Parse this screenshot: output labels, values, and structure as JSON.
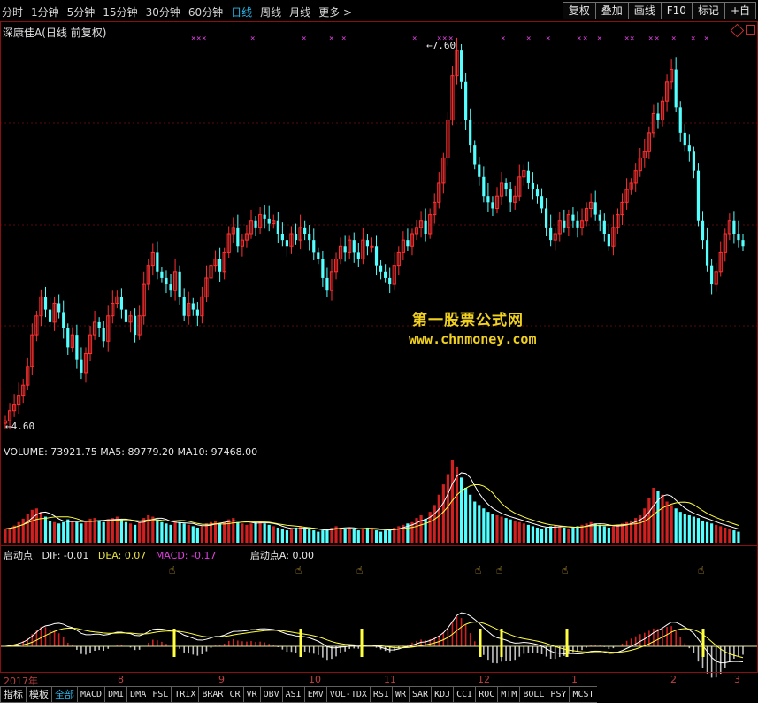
{
  "toolbar": {
    "periods": [
      "分时",
      "1分钟",
      "5分钟",
      "15分钟",
      "30分钟",
      "60分钟",
      "日线",
      "周线",
      "月线",
      "更多 >"
    ],
    "active_period": "日线",
    "tools": [
      "复权",
      "叠加",
      "画线",
      "F10",
      "标记",
      "+自"
    ]
  },
  "stock": {
    "title": "深康佳A(日线 前复权)",
    "high_label": "7.60",
    "low_label": "4.60"
  },
  "watermark": {
    "line1": "第一股票公式网",
    "line2": "www.chnmoney.com"
  },
  "volume": {
    "label": "VOLUME: 73921.75  MA5: 89779.20  MA10: 97468.00"
  },
  "macd": {
    "name": "启动点",
    "dif": "DIF: -0.01",
    "dea": "DEA: 0.07",
    "macd": "MACD: -0.17",
    "signal": "启动点A: 0.00"
  },
  "time_axis": [
    "2017年",
    "8",
    "9",
    "10",
    "11",
    "12",
    "1",
    "2",
    "3"
  ],
  "bottom_tabs": [
    "指标",
    "模板",
    "全部",
    "MACD",
    "DMI",
    "DMA",
    "FSL",
    "TRIX",
    "BRAR",
    "CR",
    "VR",
    "OBV",
    "ASI",
    "EMV",
    "VOL-TDX",
    "RSI",
    "WR",
    "SAR",
    "KDJ",
    "CCI",
    "ROC",
    "MTM",
    "BOLL",
    "PSY",
    "MCST"
  ],
  "bottom_selected": "全部",
  "colors": {
    "up": "#ff3030",
    "down": "#54ffff",
    "ma_white": "#ffffff",
    "ma_yellow": "#ffff40",
    "grid": "#8a1010",
    "signal": "#ffff40"
  },
  "chart_data": {
    "type": "candlestick",
    "price_range": [
      4.6,
      7.6
    ],
    "closes": [
      4.62,
      4.7,
      4.75,
      4.82,
      4.9,
      5.05,
      5.3,
      5.45,
      5.6,
      5.5,
      5.4,
      5.55,
      5.48,
      5.35,
      5.2,
      5.3,
      5.1,
      5.0,
      5.15,
      5.3,
      5.4,
      5.35,
      5.25,
      5.45,
      5.55,
      5.6,
      5.5,
      5.4,
      5.45,
      5.3,
      5.45,
      5.7,
      5.85,
      5.95,
      5.8,
      5.75,
      5.7,
      5.65,
      5.8,
      5.6,
      5.45,
      5.55,
      5.5,
      5.45,
      5.6,
      5.75,
      5.85,
      5.9,
      5.8,
      5.95,
      6.1,
      6.15,
      6.0,
      6.05,
      6.1,
      6.2,
      6.15,
      6.25,
      6.22,
      6.18,
      6.2,
      6.1,
      6.05,
      6.0,
      6.1,
      6.05,
      6.15,
      6.1,
      6.05,
      5.95,
      5.9,
      5.75,
      5.65,
      5.8,
      5.9,
      6.0,
      5.95,
      6.05,
      5.95,
      5.9,
      6.05,
      6.0,
      6.0,
      5.85,
      5.8,
      5.75,
      5.7,
      5.85,
      5.95,
      6.05,
      6.0,
      6.1,
      6.15,
      6.2,
      6.1,
      6.25,
      6.35,
      6.5,
      6.7,
      7.0,
      7.35,
      7.55,
      7.3,
      7.0,
      6.8,
      6.65,
      6.55,
      6.4,
      6.35,
      6.3,
      6.4,
      6.5,
      6.45,
      6.35,
      6.4,
      6.55,
      6.6,
      6.5,
      6.45,
      6.4,
      6.3,
      6.15,
      6.05,
      6.1,
      6.2,
      6.15,
      6.25,
      6.2,
      6.15,
      6.2,
      6.3,
      6.35,
      6.25,
      6.2,
      6.1,
      6.0,
      6.15,
      6.25,
      6.35,
      6.45,
      6.5,
      6.6,
      6.7,
      6.75,
      6.9,
      7.05,
      7.0,
      7.15,
      7.3,
      7.4,
      7.1,
      6.9,
      6.8,
      6.75,
      6.6,
      6.2,
      6.05,
      5.85,
      5.7,
      5.8,
      5.95,
      6.1,
      6.2,
      6.1,
      6.05,
      6.0
    ],
    "volumes": [
      20,
      22,
      25,
      30,
      35,
      42,
      48,
      50,
      45,
      38,
      32,
      30,
      28,
      30,
      34,
      32,
      30,
      28,
      30,
      35,
      36,
      32,
      30,
      34,
      36,
      38,
      34,
      30,
      28,
      26,
      30,
      36,
      40,
      38,
      34,
      30,
      28,
      26,
      32,
      30,
      28,
      26,
      24,
      22,
      24,
      28,
      30,
      32,
      28,
      30,
      34,
      36,
      30,
      28,
      26,
      28,
      30,
      32,
      28,
      26,
      24,
      22,
      20,
      18,
      20,
      22,
      24,
      22,
      20,
      18,
      16,
      18,
      20,
      22,
      24,
      22,
      20,
      22,
      20,
      18,
      20,
      22,
      20,
      18,
      16,
      18,
      20,
      22,
      24,
      26,
      28,
      30,
      36,
      40,
      35,
      45,
      55,
      70,
      85,
      100,
      120,
      110,
      95,
      80,
      70,
      60,
      55,
      50,
      45,
      42,
      40,
      38,
      36,
      34,
      32,
      30,
      28,
      26,
      24,
      22,
      20,
      22,
      24,
      26,
      24,
      22,
      20,
      22,
      24,
      26,
      28,
      30,
      28,
      26,
      24,
      22,
      24,
      26,
      28,
      30,
      32,
      36,
      40,
      50,
      65,
      80,
      75,
      70,
      60,
      55,
      50,
      45,
      42,
      40,
      38,
      36,
      32,
      30,
      28,
      26,
      24,
      22,
      20,
      18,
      16
    ]
  }
}
